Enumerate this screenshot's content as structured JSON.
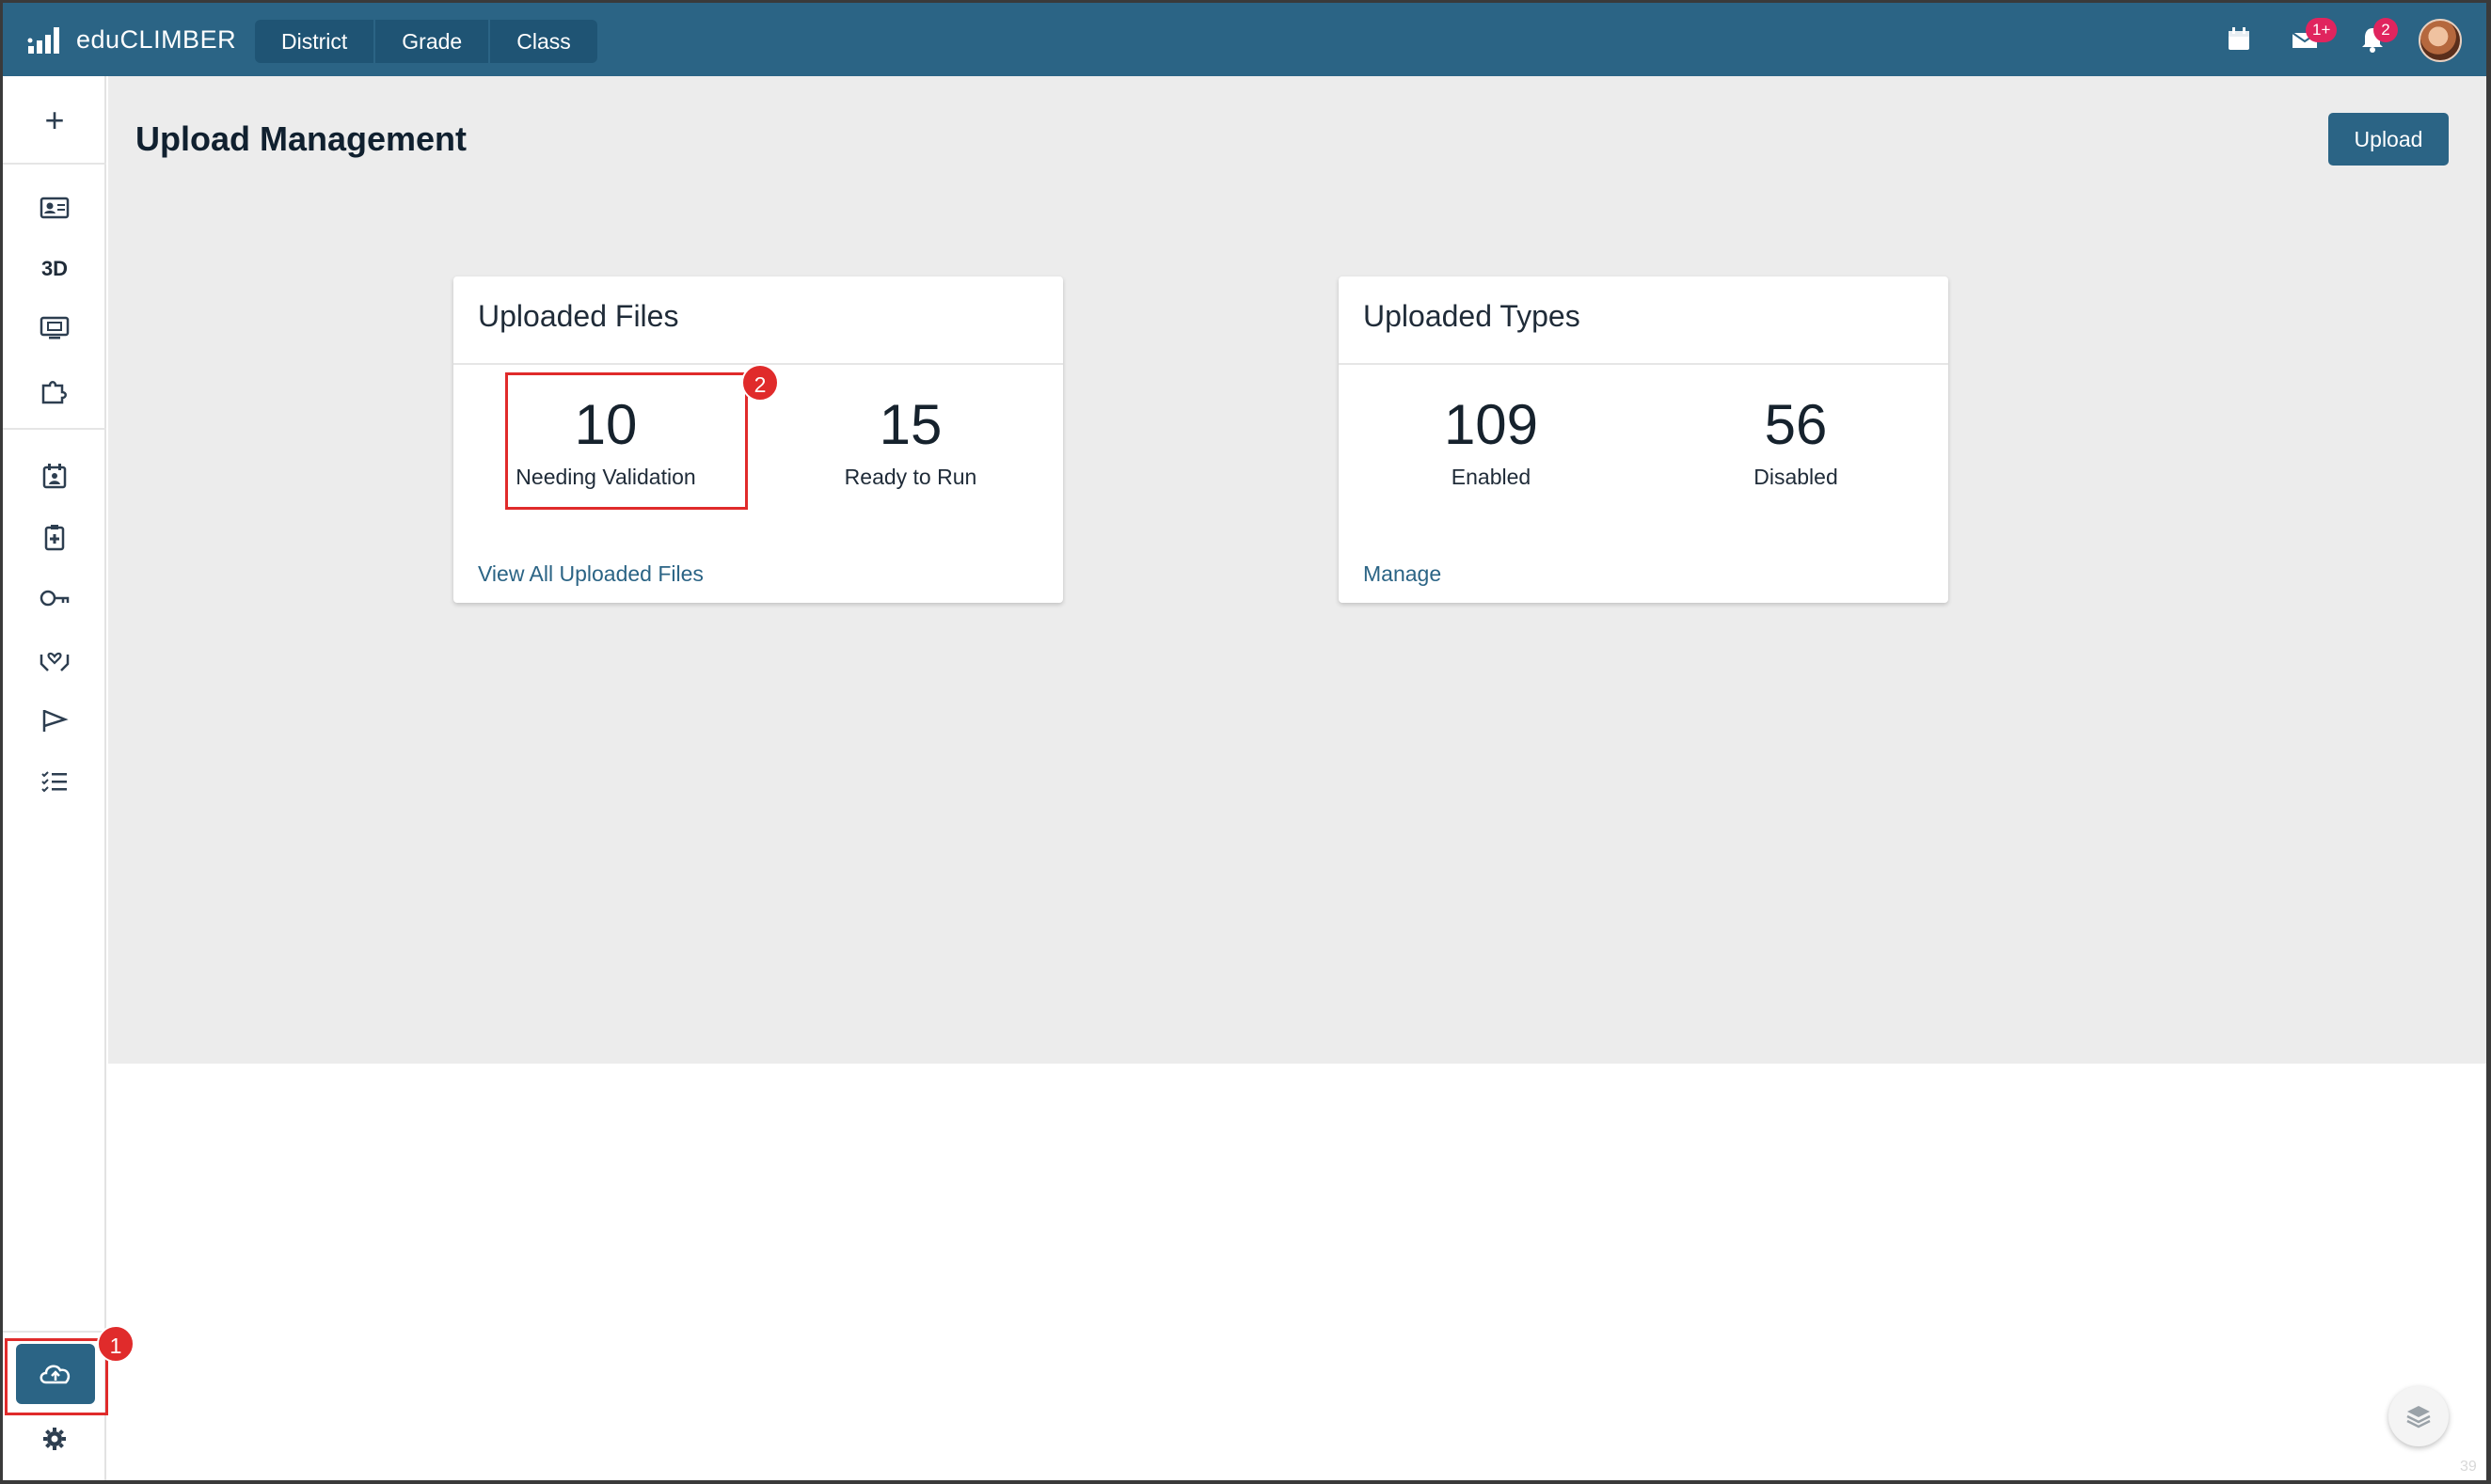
{
  "app": {
    "brand": "eduCLIMBER"
  },
  "scope_tabs": [
    "District",
    "Grade",
    "Class"
  ],
  "header_badges": {
    "messages": "1+",
    "notifications": "2"
  },
  "page": {
    "title": "Upload Management",
    "upload_button": "Upload"
  },
  "sidebar": {
    "add_label": "+",
    "three_d_label": "3D",
    "icons": [
      "id-card-icon",
      "3d-label",
      "monitor-icon",
      "puzzle-icon",
      "calendar-person-icon",
      "clipboard-health-icon",
      "key-icon",
      "hands-heart-icon",
      "flag-icon",
      "checklist-icon",
      "cloud-upload-icon",
      "gear-icon"
    ]
  },
  "cards": {
    "uploaded_files": {
      "title": "Uploaded Files",
      "stats": [
        {
          "value": "10",
          "label": "Needing Validation"
        },
        {
          "value": "15",
          "label": "Ready to Run"
        }
      ],
      "link": "View All Uploaded Files"
    },
    "uploaded_types": {
      "title": "Uploaded Types",
      "stats": [
        {
          "value": "109",
          "label": "Enabled"
        },
        {
          "value": "56",
          "label": "Disabled"
        }
      ],
      "link": "Manage"
    }
  },
  "annotations": {
    "step1": "1",
    "step2": "2"
  },
  "footer": {
    "page_number": "39"
  },
  "colors": {
    "primary": "#2b6485",
    "background": "#ececec",
    "highlight": "#e02b2b",
    "badge": "#e0245e"
  }
}
